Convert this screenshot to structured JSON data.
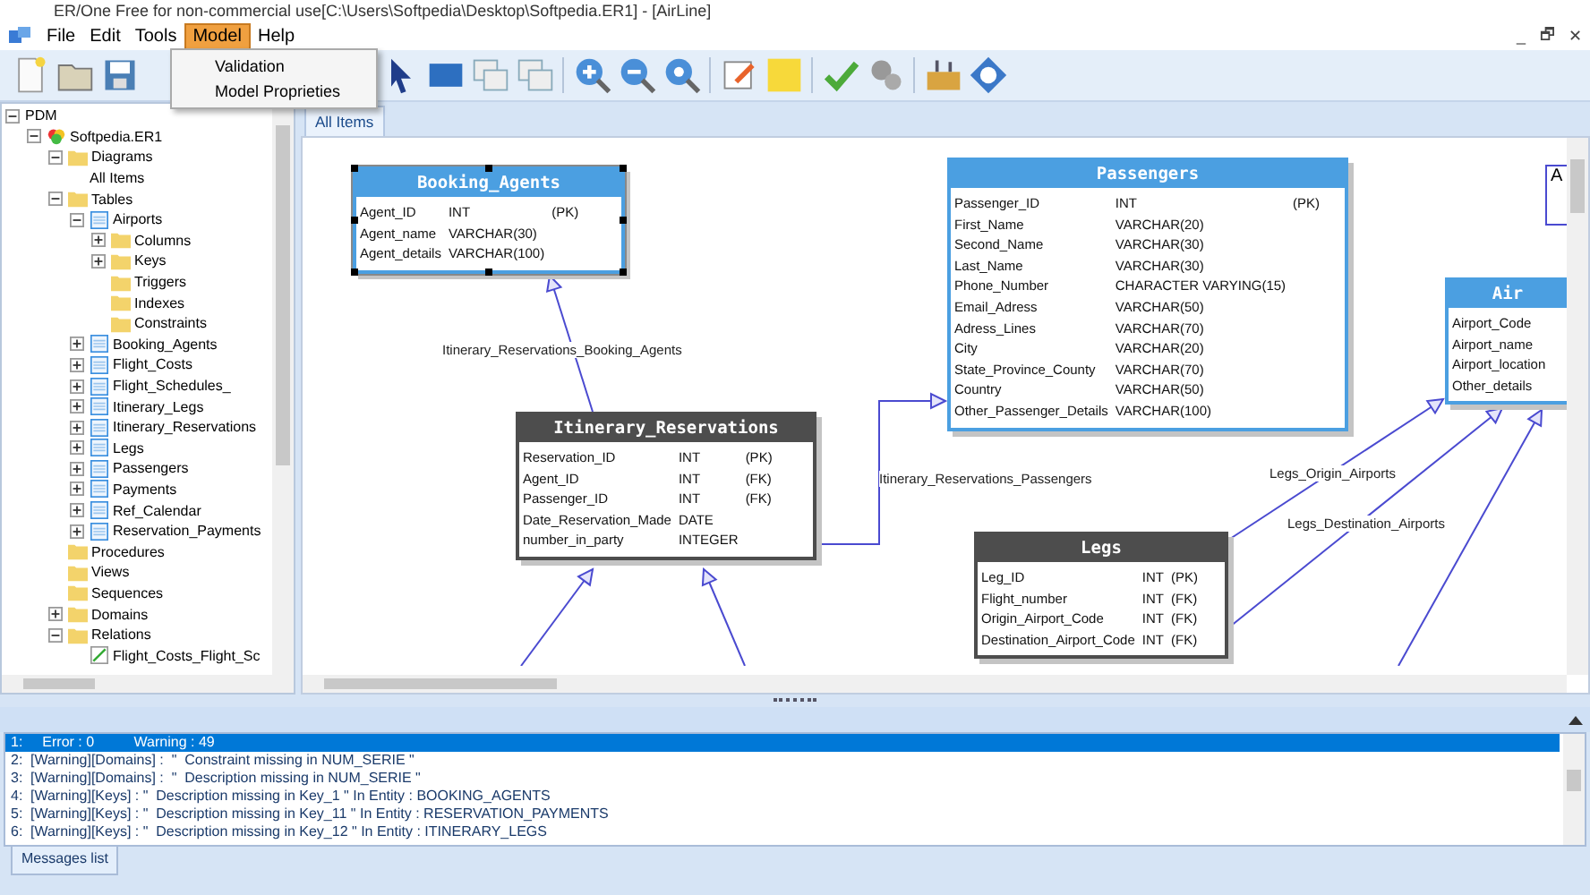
{
  "window": {
    "title": "ER/One Free for non-commercial use[C:\\Users\\Softpedia\\Desktop\\Softpedia.ER1] - [AirLine]"
  },
  "menu": [
    {
      "label": "File",
      "selected": false
    },
    {
      "label": "Edit",
      "selected": false
    },
    {
      "label": "Tools",
      "selected": false
    },
    {
      "label": "Model",
      "selected": true
    },
    {
      "label": "Help",
      "selected": false
    }
  ],
  "dropdown": [
    {
      "label": "Validation"
    },
    {
      "label": "Model Proprieties"
    }
  ],
  "mdi_controls": [
    "_",
    "🗗",
    "✕"
  ],
  "tree": [
    {
      "label": "PDM",
      "expanded": true,
      "children": [
        {
          "label": "Softpedia.ER1",
          "kind": "database",
          "expanded": true,
          "children": [
            {
              "label": "Diagrams",
              "kind": "folder",
              "expanded": true,
              "children": [
                {
                  "label": "All Items"
                }
              ]
            },
            {
              "label": "Tables",
              "kind": "folder",
              "expanded": true,
              "children": [
                {
                  "label": "Airports",
                  "kind": "table",
                  "expanded": true,
                  "children": [
                    {
                      "label": "Columns",
                      "kind": "folder",
                      "expanded": false
                    },
                    {
                      "label": "Keys",
                      "kind": "folder",
                      "expanded": false
                    },
                    {
                      "label": "Triggers",
                      "kind": "folder"
                    },
                    {
                      "label": "Indexes",
                      "kind": "folder"
                    },
                    {
                      "label": "Constraints",
                      "kind": "folder"
                    }
                  ]
                },
                {
                  "label": "Booking_Agents",
                  "kind": "table",
                  "expanded": false
                },
                {
                  "label": "Flight_Costs",
                  "kind": "table",
                  "expanded": false
                },
                {
                  "label": "Flight_Schedules_",
                  "kind": "table",
                  "expanded": false
                },
                {
                  "label": "Itinerary_Legs",
                  "kind": "table",
                  "expanded": false
                },
                {
                  "label": "Itinerary_Reservations",
                  "kind": "table",
                  "expanded": false
                },
                {
                  "label": "Legs",
                  "kind": "table",
                  "expanded": false
                },
                {
                  "label": "Passengers",
                  "kind": "table",
                  "expanded": false
                },
                {
                  "label": "Payments",
                  "kind": "table",
                  "expanded": false
                },
                {
                  "label": "Ref_Calendar",
                  "kind": "table",
                  "expanded": false
                },
                {
                  "label": "Reservation_Payments",
                  "kind": "table",
                  "expanded": false
                }
              ]
            },
            {
              "label": "Procedures",
              "kind": "folder"
            },
            {
              "label": "Views",
              "kind": "folder"
            },
            {
              "label": "Sequences",
              "kind": "folder"
            },
            {
              "label": "Domains",
              "kind": "folder",
              "expanded": false
            },
            {
              "label": "Relations",
              "kind": "folder",
              "expanded": true,
              "children": [
                {
                  "label": "Flight_Costs_Flight_Sc",
                  "kind": "relation"
                }
              ]
            }
          ]
        }
      ]
    }
  ],
  "tabs": [
    {
      "label": "All Items",
      "selected": true
    }
  ],
  "entities": [
    {
      "name": "Booking_Agents",
      "color": "#4b9fe1",
      "selected": true,
      "columns": [
        {
          "name": "Agent_ID",
          "type": "INT",
          "key": "(PK)"
        },
        {
          "name": "Agent_name",
          "type": "VARCHAR(30)"
        },
        {
          "name": "Agent_details",
          "type": "VARCHAR(100)"
        }
      ]
    },
    {
      "name": "Passengers",
      "color": "#4b9fe1",
      "selected": false,
      "columns": [
        {
          "name": "Passenger_ID",
          "type": "INT",
          "key": "(PK)"
        },
        {
          "name": "First_Name",
          "type": "VARCHAR(20)"
        },
        {
          "name": "Second_Name",
          "type": "VARCHAR(30)"
        },
        {
          "name": "Last_Name",
          "type": "VARCHAR(30)"
        },
        {
          "name": "Phone_Number",
          "type": "CHARACTER VARYING(15)"
        },
        {
          "name": "Email_Adress",
          "type": "VARCHAR(50)"
        },
        {
          "name": "Adress_Lines",
          "type": "VARCHAR(70)"
        },
        {
          "name": "City",
          "type": "VARCHAR(20)"
        },
        {
          "name": "State_Province_County",
          "type": "VARCHAR(70)"
        },
        {
          "name": "Country",
          "type": "VARCHAR(50)"
        },
        {
          "name": "Other_Passenger_Details",
          "type": "VARCHAR(100)"
        }
      ]
    },
    {
      "name": "Itinerary_Reservations",
      "color": "#4d4d4d",
      "selected": false,
      "columns": [
        {
          "name": "Reservation_ID",
          "type": "INT",
          "key": "(PK)"
        },
        {
          "name": "Agent_ID",
          "type": "INT",
          "key": "(FK)"
        },
        {
          "name": "Passenger_ID",
          "type": "INT",
          "key": "(FK)"
        },
        {
          "name": "Date_Reservation_Made",
          "type": "DATE"
        },
        {
          "name": "number_in_party",
          "type": "INTEGER"
        }
      ]
    },
    {
      "name": "Legs",
      "color": "#4d4d4d",
      "selected": false,
      "columns": [
        {
          "name": "Leg_ID",
          "type": "INT",
          "key": "(PK)"
        },
        {
          "name": "Flight_number",
          "type": "INT",
          "key": "(FK)"
        },
        {
          "name": "Origin_Airport_Code",
          "type": "INT",
          "key": "(FK)"
        },
        {
          "name": "Destination_Airport_Code",
          "type": "INT",
          "key": "(FK)"
        }
      ]
    },
    {
      "name": "Air",
      "color": "#4b9fe1",
      "selected": false,
      "columns": [
        {
          "name": "Airport_Code"
        },
        {
          "name": "Airport_name"
        },
        {
          "name": "Airport_location"
        },
        {
          "name": "Other_details"
        }
      ]
    }
  ],
  "note": {
    "text": "A"
  },
  "relation_labels": [
    "Itinerary_Reservations_Booking_Agents",
    "Itinerary_Reservations_Passengers",
    "Legs_Origin_Airports",
    "Legs_Destination_Airports"
  ],
  "messages": [
    {
      "num": "1:",
      "text": "   Error : 0          Warning : 49",
      "selected": true
    },
    {
      "num": "2:",
      "text": "[Warning][Domains] :  \"  Constraint missing in NUM_SERIE \"",
      "selected": false
    },
    {
      "num": "3:",
      "text": "[Warning][Domains] :  \"  Description missing in NUM_SERIE \"",
      "selected": false
    },
    {
      "num": "4:",
      "text": "[Warning][Keys] : \"  Description missing in Key_1 \" In Entity : BOOKING_AGENTS",
      "selected": false
    },
    {
      "num": "5:",
      "text": "[Warning][Keys] : \"  Description missing in Key_11 \" In Entity : RESERVATION_PAYMENTS",
      "selected": false
    },
    {
      "num": "6:",
      "text": "[Warning][Keys] : \"  Description missing in Key_12 \" In Entity : ITINERARY_LEGS",
      "selected": false
    }
  ],
  "bottom_tabs": [
    {
      "label": "Messages list",
      "selected": true
    }
  ]
}
